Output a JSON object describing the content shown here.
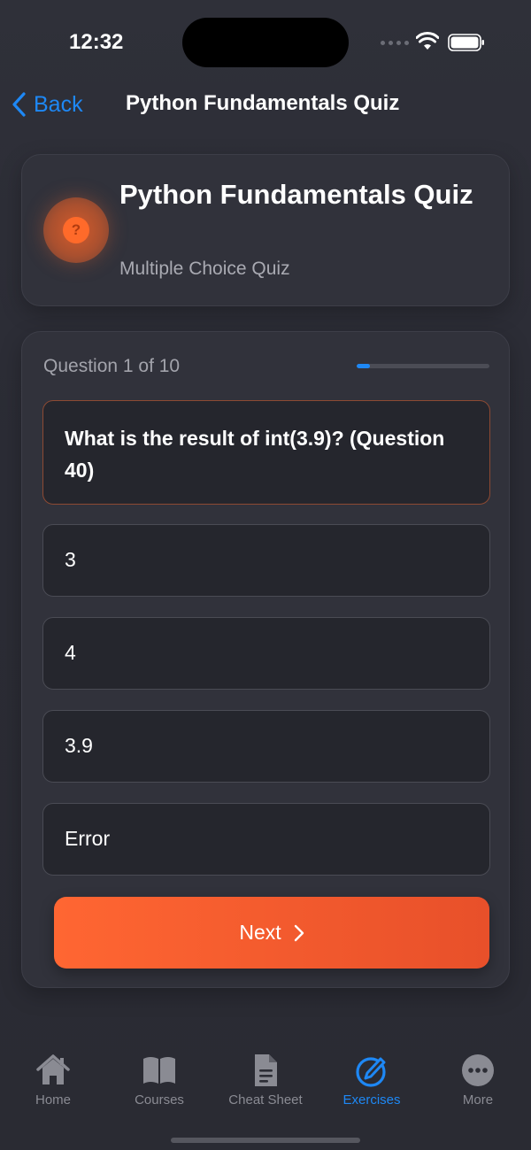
{
  "status_bar": {
    "time": "12:32"
  },
  "nav": {
    "back_label": "Back",
    "title": "Python Fundamentals Quiz"
  },
  "header": {
    "badge_icon": "question-mark-icon",
    "badge_glyph": "?",
    "title": "Python Fundamentals Quiz",
    "subtitle": "Multiple Choice Quiz"
  },
  "quiz": {
    "progress_label": "Question 1 of 10",
    "progress_fraction": 0.1,
    "question": "What is the result of int(3.9)? (Question 40)",
    "options": [
      {
        "label": "3"
      },
      {
        "label": "4"
      },
      {
        "label": "3.9"
      },
      {
        "label": "Error"
      }
    ],
    "next_label": "Next"
  },
  "tabs": [
    {
      "label": "Home",
      "icon": "house-icon",
      "active": false
    },
    {
      "label": "Courses",
      "icon": "book-icon",
      "active": false
    },
    {
      "label": "Cheat Sheet",
      "icon": "document-icon",
      "active": false
    },
    {
      "label": "Exercises",
      "icon": "pencil-circle-icon",
      "active": true
    },
    {
      "label": "More",
      "icon": "ellipsis-circle-icon",
      "active": false
    }
  ],
  "colors": {
    "accent": "#1e88f5",
    "primary_button": "#ff6632",
    "badge": "#ff6a2a",
    "background": "#2c2d36"
  }
}
